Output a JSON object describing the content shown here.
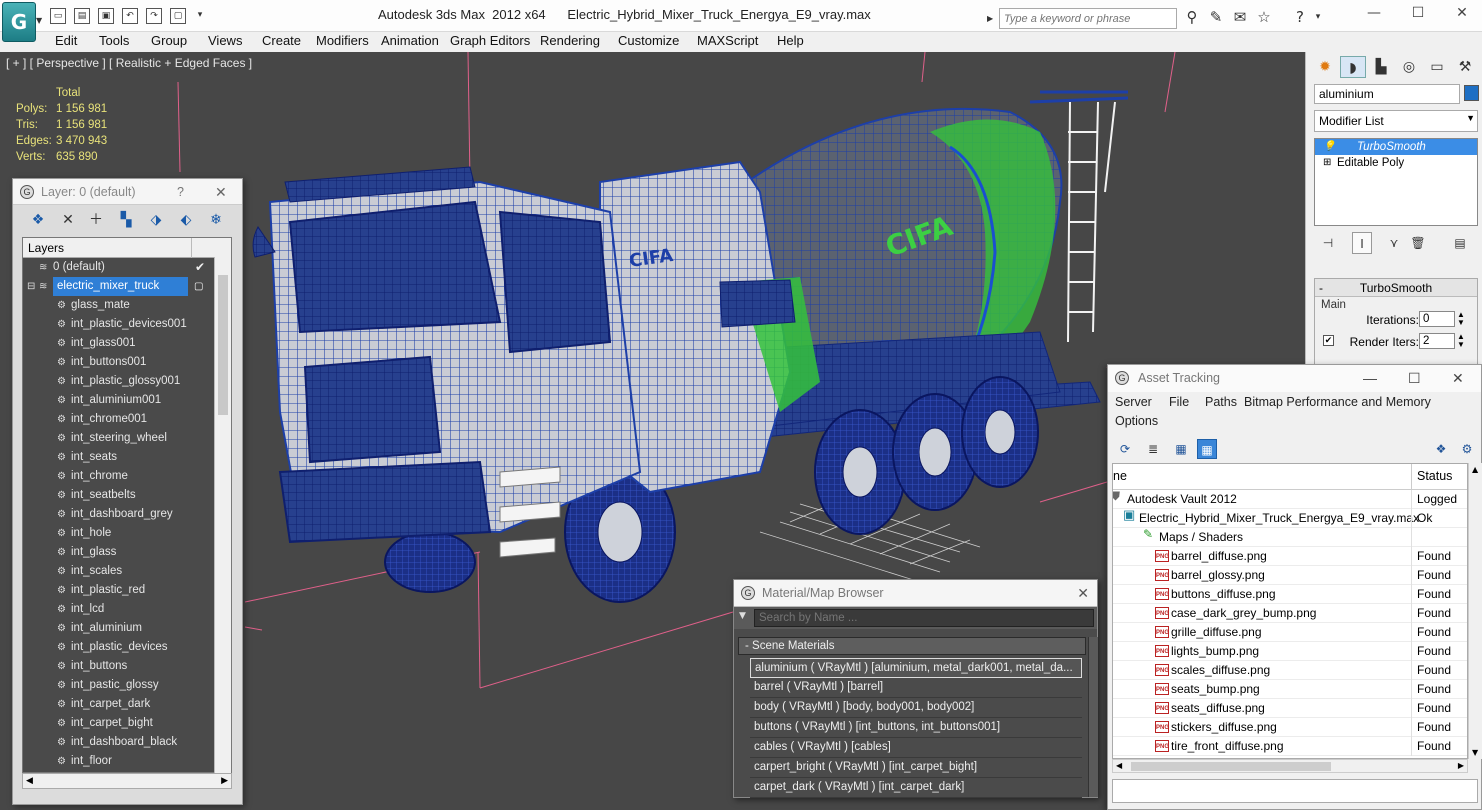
{
  "window": {
    "app_title": "Autodesk 3ds Max  2012 x64",
    "file_title": "Electric_Hybrid_Mixer_Truck_Energya_E9_vray.max",
    "search_placeholder": "Type a keyword or phrase",
    "logo_glyph": "G"
  },
  "menu": [
    "Edit",
    "Tools",
    "Group",
    "Views",
    "Create",
    "Modifiers",
    "Animation",
    "Graph Editors",
    "Rendering",
    "Customize",
    "MAXScript",
    "Help"
  ],
  "viewport": {
    "label": "[ + ] [ Perspective ] [ Realistic + Edged Faces ]",
    "stats_header": "Total",
    "stats": [
      {
        "key": "Polys:",
        "value": "1 156 981"
      },
      {
        "key": "Tris:",
        "value": "1 156 981"
      },
      {
        "key": "Edges:",
        "value": "3 470 943"
      },
      {
        "key": "Verts:",
        "value": "635 890"
      }
    ],
    "truck_brand": "CIFA"
  },
  "command_panel": {
    "object_name": "aluminium",
    "object_color": "#1e6fc4",
    "modifier_list": "Modifier List",
    "stack": [
      {
        "label": "TurboSmooth",
        "selected": true
      },
      {
        "label": "Editable Poly",
        "selected": false
      }
    ],
    "turbosmooth": {
      "title": "TurboSmooth",
      "group": "Main",
      "iterations_label": "Iterations:",
      "iterations_value": "0",
      "render_iters_label": "Render Iters:",
      "render_iters_value": "2"
    }
  },
  "layer_dialog": {
    "title": "Layer: 0 (default)",
    "help": "?",
    "header": "Layers",
    "layers": [
      {
        "name": "0 (default)",
        "level": 0,
        "icon": "layer-icon",
        "checked": true
      },
      {
        "name": "electric_mixer_truck",
        "level": 0,
        "icon": "layer-icon",
        "selected": true
      },
      {
        "name": "glass_mate",
        "level": 1
      },
      {
        "name": "int_plastic_devices001",
        "level": 1
      },
      {
        "name": "int_glass001",
        "level": 1
      },
      {
        "name": "int_buttons001",
        "level": 1
      },
      {
        "name": "int_plastic_glossy001",
        "level": 1
      },
      {
        "name": "int_aluminium001",
        "level": 1
      },
      {
        "name": "int_chrome001",
        "level": 1
      },
      {
        "name": "int_steering_wheel",
        "level": 1
      },
      {
        "name": "int_seats",
        "level": 1
      },
      {
        "name": "int_chrome",
        "level": 1
      },
      {
        "name": "int_seatbelts",
        "level": 1
      },
      {
        "name": "int_dashboard_grey",
        "level": 1
      },
      {
        "name": "int_hole",
        "level": 1
      },
      {
        "name": "int_glass",
        "level": 1
      },
      {
        "name": "int_scales",
        "level": 1
      },
      {
        "name": "int_plastic_red",
        "level": 1
      },
      {
        "name": "int_lcd",
        "level": 1
      },
      {
        "name": "int_aluminium",
        "level": 1
      },
      {
        "name": "int_plastic_devices",
        "level": 1
      },
      {
        "name": "int_buttons",
        "level": 1
      },
      {
        "name": "int_pastic_glossy",
        "level": 1
      },
      {
        "name": "int_carpet_dark",
        "level": 1
      },
      {
        "name": "int_carpet_bight",
        "level": 1
      },
      {
        "name": "int_dashboard_black",
        "level": 1
      },
      {
        "name": "int_floor",
        "level": 1
      }
    ]
  },
  "material_browser": {
    "title": "Material/Map Browser",
    "search_placeholder": "Search by Name ...",
    "group": "- Scene Materials",
    "materials": [
      "aluminium  ( VRayMtl )  [aluminium, metal_dark001, metal_da...",
      "barrel  ( VRayMtl )  [barrel]",
      "body  ( VRayMtl )  [body, body001, body002]",
      "buttons  ( VRayMtl )  [int_buttons, int_buttons001]",
      "cables  ( VRayMtl )  [cables]",
      "carpert_bright  ( VRayMtl )  [int_carpet_bight]",
      "carpet_dark  ( VRayMtl )  [int_carpet_dark]"
    ]
  },
  "asset_tracking": {
    "title": "Asset Tracking",
    "menu": [
      "Server",
      "File",
      "Paths",
      "Bitmap Performance and Memory",
      "Options"
    ],
    "col_name": "ne",
    "col_status": "Status",
    "rows": [
      {
        "name": "Autodesk Vault 2012",
        "status": "Logged",
        "level": 0,
        "icon": "vault-icon"
      },
      {
        "name": "Electric_Hybrid_Mixer_Truck_Energya_E9_vray.max",
        "status": "Ok",
        "level": 1,
        "icon": "max-file-icon"
      },
      {
        "name": "Maps / Shaders",
        "status": "",
        "level": 2,
        "icon": "maps-icon"
      },
      {
        "name": "barrel_diffuse.png",
        "status": "Found",
        "level": 3,
        "icon": "png-icon"
      },
      {
        "name": "barrel_glossy.png",
        "status": "Found",
        "level": 3,
        "icon": "png-icon"
      },
      {
        "name": "buttons_diffuse.png",
        "status": "Found",
        "level": 3,
        "icon": "png-icon"
      },
      {
        "name": "case_dark_grey_bump.png",
        "status": "Found",
        "level": 3,
        "icon": "png-icon"
      },
      {
        "name": "grille_diffuse.png",
        "status": "Found",
        "level": 3,
        "icon": "png-icon"
      },
      {
        "name": "lights_bump.png",
        "status": "Found",
        "level": 3,
        "icon": "png-icon"
      },
      {
        "name": "scales_diffuse.png",
        "status": "Found",
        "level": 3,
        "icon": "png-icon"
      },
      {
        "name": "seats_bump.png",
        "status": "Found",
        "level": 3,
        "icon": "png-icon"
      },
      {
        "name": "seats_diffuse.png",
        "status": "Found",
        "level": 3,
        "icon": "png-icon"
      },
      {
        "name": "stickers_diffuse.png",
        "status": "Found",
        "level": 3,
        "icon": "png-icon"
      },
      {
        "name": "tire_front_diffuse.png",
        "status": "Found",
        "level": 3,
        "icon": "png-icon"
      }
    ]
  }
}
